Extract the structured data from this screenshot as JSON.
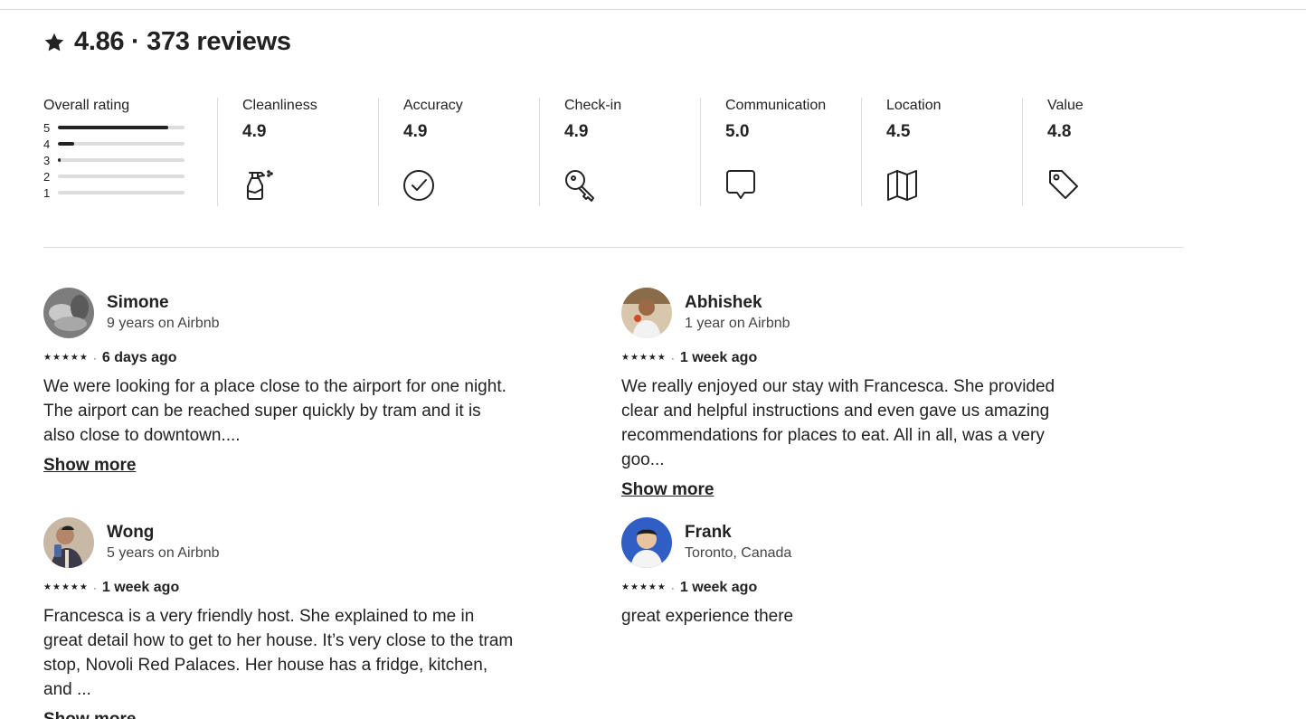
{
  "summary": {
    "rating": "4.86",
    "separator": "·",
    "reviews": "373 reviews"
  },
  "overall": {
    "label": "Overall rating",
    "distribution": [
      {
        "stars": "5",
        "fraction": 0.87
      },
      {
        "stars": "4",
        "fraction": 0.13
      },
      {
        "stars": "3",
        "fraction": 0.02
      },
      {
        "stars": "2",
        "fraction": 0.0
      },
      {
        "stars": "1",
        "fraction": 0.0
      }
    ]
  },
  "categories": [
    {
      "label": "Cleanliness",
      "value": "4.9",
      "icon": "spray-bottle-icon"
    },
    {
      "label": "Accuracy",
      "value": "4.9",
      "icon": "check-circle-icon"
    },
    {
      "label": "Check-in",
      "value": "4.9",
      "icon": "key-icon"
    },
    {
      "label": "Communication",
      "value": "5.0",
      "icon": "chat-bubble-icon"
    },
    {
      "label": "Location",
      "value": "4.5",
      "icon": "map-icon"
    },
    {
      "label": "Value",
      "value": "4.8",
      "icon": "price-tag-icon"
    }
  ],
  "reviews": [
    {
      "name": "Simone",
      "meta": "9 years on Airbnb",
      "stars": "★★★★★",
      "date": "6 days ago",
      "text": "We were looking for a place close to the airport for one night. The airport can be reached super quickly by tram and it is also close to downtown....",
      "show_more": "Show more",
      "avatar_color": "#8a8a8a"
    },
    {
      "name": "Abhishek",
      "meta": "1 year on Airbnb",
      "stars": "★★★★★",
      "date": "1 week ago",
      "text": "We really enjoyed our stay with Francesca. She provided clear and helpful instructions and even gave us amazing recommendations for places to eat. All in all, was a very goo...",
      "show_more": "Show more",
      "avatar_color": "#b08a62"
    },
    {
      "name": "Wong",
      "meta": "5 years on Airbnb",
      "stars": "★★★★★",
      "date": "1 week ago",
      "text": "Francesca is a very friendly host. She explained to me in great detail how to get to her house. It’s very close to the tram stop, Novoli Red Palaces. Her house has a fridge, kitchen, and ...",
      "show_more": "Show more",
      "avatar_color": "#9a8270"
    },
    {
      "name": "Frank",
      "meta": "Toronto, Canada",
      "stars": "★★★★★",
      "date": "1 week ago",
      "text": "great experience there",
      "show_more": "",
      "avatar_color": "#2f5fc4"
    }
  ]
}
